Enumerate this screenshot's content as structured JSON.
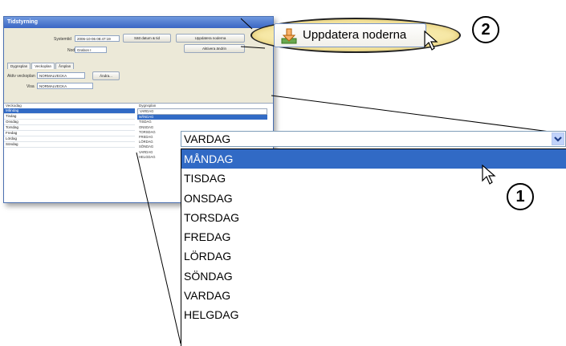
{
  "window": {
    "title": "Tidstyrning",
    "system_label": "Systemtid",
    "system_time": "2006-10-06 08:47:19",
    "set_date_button": "Sätt datum & tid",
    "update_nodes_button": "Uppdatera noderna",
    "node_label": "Nod",
    "node_value": "Grabon I",
    "activate_button": "Aktivera ändrin",
    "tabs": [
      "Dygnsplan",
      "Veckoplan",
      "Årsplan"
    ],
    "active_week_label": "Aktiv veckoplan",
    "active_week_value": "NORMALVECKA",
    "change_button": "Ändra...",
    "show_label": "Visa",
    "show_value": "NORMALVECKA",
    "col_weekday": "Veckodag",
    "col_schedule": "Dygnsplan",
    "weekdays": [
      "Måndag",
      "Tisdag",
      "Onsdag",
      "Torsdag",
      "Fredag",
      "Lördag",
      "Söndag"
    ],
    "mini_options": [
      "VARDAG",
      "MÅNDAG",
      "TISDAG",
      "ONSDAG",
      "TORSDAG",
      "FREDAG",
      "LÖRDAG",
      "SÖNDAG",
      "VARDAG",
      "HELGDAG"
    ]
  },
  "dropdown": {
    "value": "VARDAG",
    "options": [
      "MÅNDAG",
      "TISDAG",
      "ONSDAG",
      "TORSDAG",
      "FREDAG",
      "LÖRDAG",
      "SÖNDAG",
      "VARDAG",
      "HELGDAG"
    ],
    "selected_index": 0
  },
  "zoom_button": {
    "label": "Uppdatera noderna",
    "icon": "download-arrow-icon"
  },
  "callouts": [
    "1",
    "2"
  ],
  "colors": {
    "selection": "#316ac5",
    "callout_fill": "#f7e9a8"
  }
}
